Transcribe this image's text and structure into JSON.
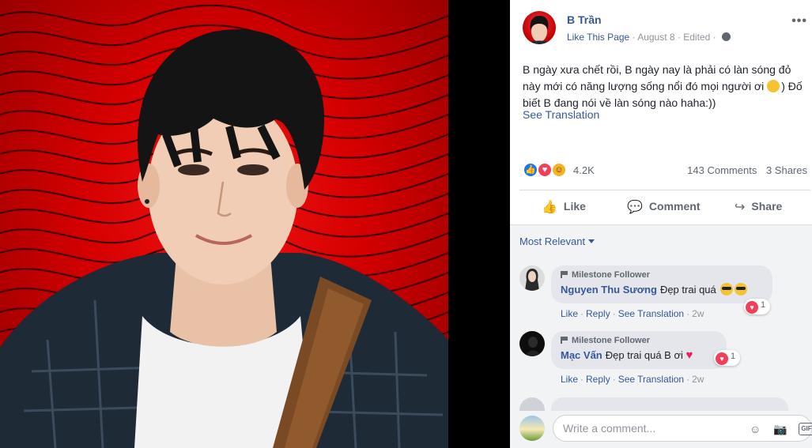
{
  "post": {
    "page_name": "B Trần",
    "like_page": "Like This Page",
    "date": "August 8",
    "edited": "Edited",
    "more": "•••",
    "text": "B ngày xưa chết rồi, B ngày nay là phải có làn sóng đỏ này mới có năng lượng sống nổi đó mọi người ơi",
    "text_end": ") Đố biết B đang nói về làn sóng nào haha:))",
    "see_translation": "See Translation"
  },
  "stats": {
    "reactions": "4.2K",
    "comments": "143 Comments",
    "shares": "3 Shares"
  },
  "actions": {
    "like": "Like",
    "comment": "Comment",
    "share": "Share"
  },
  "comments": {
    "sort_label": "Most Relevant",
    "items": [
      {
        "badge": "Milestone Follower",
        "author": "Nguyen Thu Sương",
        "text": "Đẹp trai quá",
        "reaction_count": "1",
        "like": "Like",
        "reply": "Reply",
        "see_translation": "See Translation",
        "time": "2w"
      },
      {
        "badge": "Milestone Follower",
        "author": "Mạc Vấn",
        "text": "Đẹp trai quá B ơi",
        "reaction_count": "1",
        "like": "Like",
        "reply": "Reply",
        "see_translation": "See Translation",
        "time": "2w"
      }
    ]
  },
  "composer": {
    "placeholder": "Write a comment...",
    "gif": "GIF"
  },
  "colors": {
    "link": "#365899",
    "photo_bg": "#d40000",
    "panel_bg": "#ffffff",
    "comments_bg": "#f2f3f5"
  }
}
